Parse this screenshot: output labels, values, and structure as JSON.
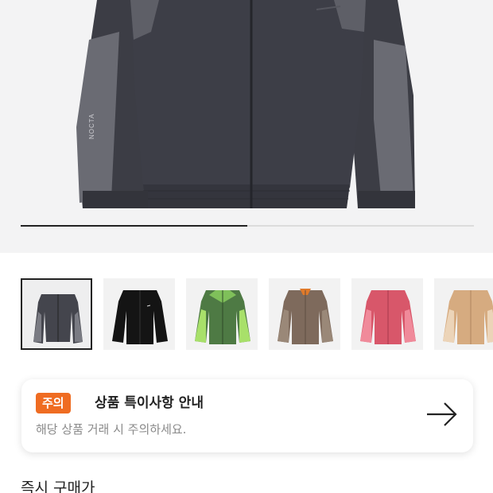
{
  "hero": {
    "image_description_icon": "jacket-image",
    "carousel_progress": 0.5,
    "chest_print": "NOCTA"
  },
  "thumbnails": [
    {
      "icon": "jacket-dark-grey-thumbnail",
      "selected": true
    },
    {
      "icon": "jacket-black-thumbnail",
      "selected": false
    },
    {
      "icon": "jacket-green-thumbnail",
      "selected": false
    },
    {
      "icon": "jacket-brown-thumbnail",
      "selected": false
    },
    {
      "icon": "jacket-pink-thumbnail",
      "selected": false
    },
    {
      "icon": "jacket-tan-thumbnail",
      "selected": false
    }
  ],
  "notice": {
    "badge": "주의",
    "title": "상품 특이사항 안내",
    "description": "해당 상품 거래 시 주의하세요.",
    "arrow_icon": "arrow-right-icon",
    "badge_color": "#ef6c22"
  },
  "price_section": {
    "title": "즉시 구매가"
  }
}
